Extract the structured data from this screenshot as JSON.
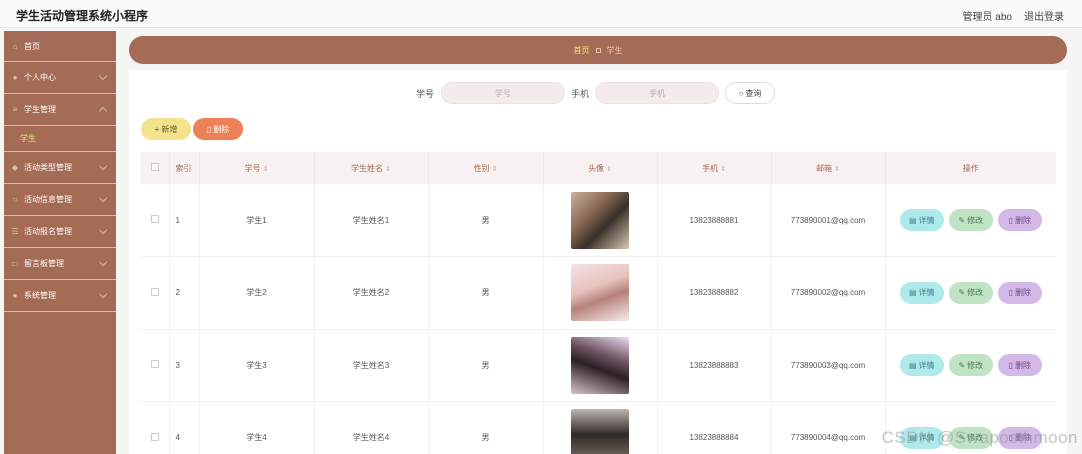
{
  "header": {
    "app_title": "学生活动管理系统小程序",
    "user_label": "管理员 abo",
    "logout_label": "退出登录"
  },
  "sidebar": {
    "items": [
      {
        "label": "首页",
        "icon": "home-icon"
      },
      {
        "label": "个人中心",
        "icon": "user-icon"
      },
      {
        "label": "学生管理",
        "icon": "menu-icon"
      },
      {
        "label": "活动类型管理",
        "icon": "tag-icon"
      },
      {
        "label": "活动信息管理",
        "icon": "info-icon"
      },
      {
        "label": "活动报名管理",
        "icon": "list-icon"
      },
      {
        "label": "留言板管理",
        "icon": "message-icon"
      },
      {
        "label": "系统管理",
        "icon": "settings-icon"
      }
    ],
    "active_sub": "学生"
  },
  "breadcrumb": {
    "home": "首页",
    "current": "学生"
  },
  "search": {
    "student_no_label": "学号",
    "student_no_placeholder": "学号",
    "phone_label": "手机",
    "phone_placeholder": "手机",
    "query_label": "查询"
  },
  "actions": {
    "add_label": "新增",
    "delete_label": "删除"
  },
  "table": {
    "headers": {
      "index": "索引",
      "student_no": "学号",
      "name": "学生姓名",
      "gender": "性别",
      "avatar": "头像",
      "phone": "手机",
      "email": "邮箱",
      "ops": "操作"
    },
    "op_labels": {
      "detail": "详情",
      "edit": "修改",
      "delete": "删除"
    },
    "rows": [
      {
        "index": "1",
        "student_no": "学生1",
        "name": "学生姓名1",
        "gender": "男",
        "phone": "13823888881",
        "email": "773890001@qq.com"
      },
      {
        "index": "2",
        "student_no": "学生2",
        "name": "学生姓名2",
        "gender": "男",
        "phone": "13823888882",
        "email": "773890002@qq.com"
      },
      {
        "index": "3",
        "student_no": "学生3",
        "name": "学生姓名3",
        "gender": "男",
        "phone": "13823888883",
        "email": "773890003@qq.com"
      },
      {
        "index": "4",
        "student_no": "学生4",
        "name": "学生姓名4",
        "gender": "男",
        "phone": "13823888884",
        "email": "773890004@qq.com"
      }
    ]
  },
  "watermark": "CSDN @Swaposthmoon",
  "colors": {
    "brand": "#a46b56",
    "add": "#f2e38c",
    "delete": "#ec8057",
    "detail": "#aee9ec",
    "edit": "#bfe3c3",
    "row_delete": "#d4b9e8"
  }
}
